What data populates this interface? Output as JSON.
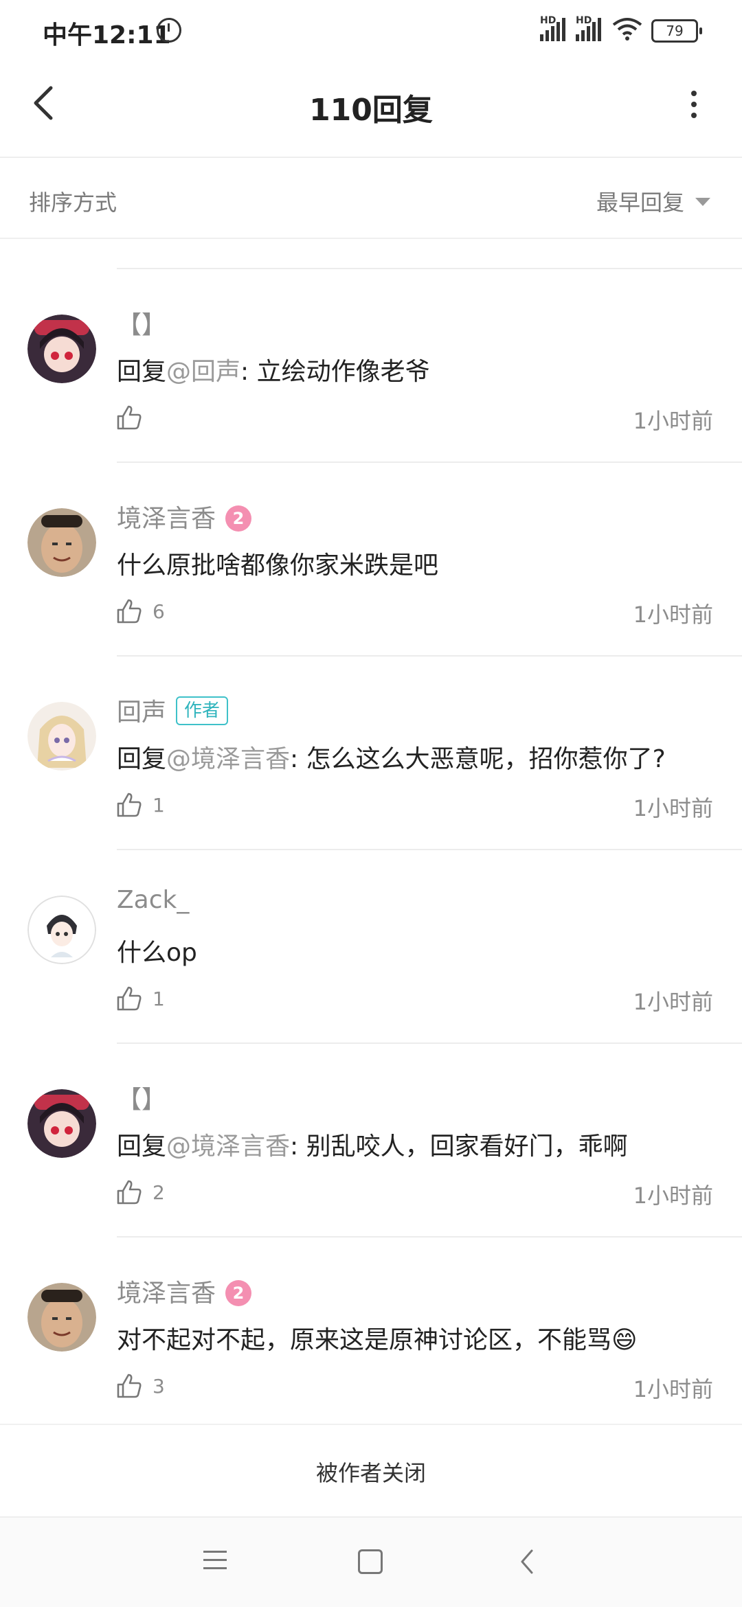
{
  "status_bar": {
    "time": "中午12:11",
    "signal1": "HD",
    "signal2": "HD",
    "battery": "79"
  },
  "header": {
    "title": "110回复"
  },
  "sort": {
    "label": "排序方式",
    "value": "最早回复"
  },
  "comments": [
    {
      "user": "【】",
      "level": "",
      "tag": "",
      "reply_prefix": "回复",
      "mention": "@回声",
      "text": ": 立绘动作像老爷",
      "likes": "",
      "time": "1小时前"
    },
    {
      "user": "境泽言香",
      "level": "2",
      "tag": "",
      "reply_prefix": "",
      "mention": "",
      "text": "什么原批啥都像你家米跌是吧",
      "likes": "6",
      "time": "1小时前"
    },
    {
      "user": "回声",
      "level": "",
      "tag": "作者",
      "reply_prefix": "回复",
      "mention": "@境泽言香",
      "text": ": 怎么这么大恶意呢，招你惹你了?",
      "likes": "1",
      "time": "1小时前"
    },
    {
      "user": "Zack_",
      "level": "",
      "tag": "",
      "reply_prefix": "",
      "mention": "",
      "text": "什么op",
      "likes": "1",
      "time": "1小时前"
    },
    {
      "user": "【】",
      "level": "",
      "tag": "",
      "reply_prefix": "回复",
      "mention": "@境泽言香",
      "text": ": 别乱咬人，回家看好门，乖啊",
      "likes": "2",
      "time": "1小时前"
    },
    {
      "user": "境泽言香",
      "level": "2",
      "tag": "",
      "reply_prefix": "",
      "mention": "",
      "text": "对不起对不起，原来这是原神讨论区，不能骂😄",
      "likes": "3",
      "time": "1小时前"
    }
  ],
  "footer": {
    "closed_text": "被作者关闭"
  },
  "colors": {
    "accent": "#2fb4bd",
    "level_badge": "#f48fb1",
    "muted": "#8c8c8c"
  }
}
